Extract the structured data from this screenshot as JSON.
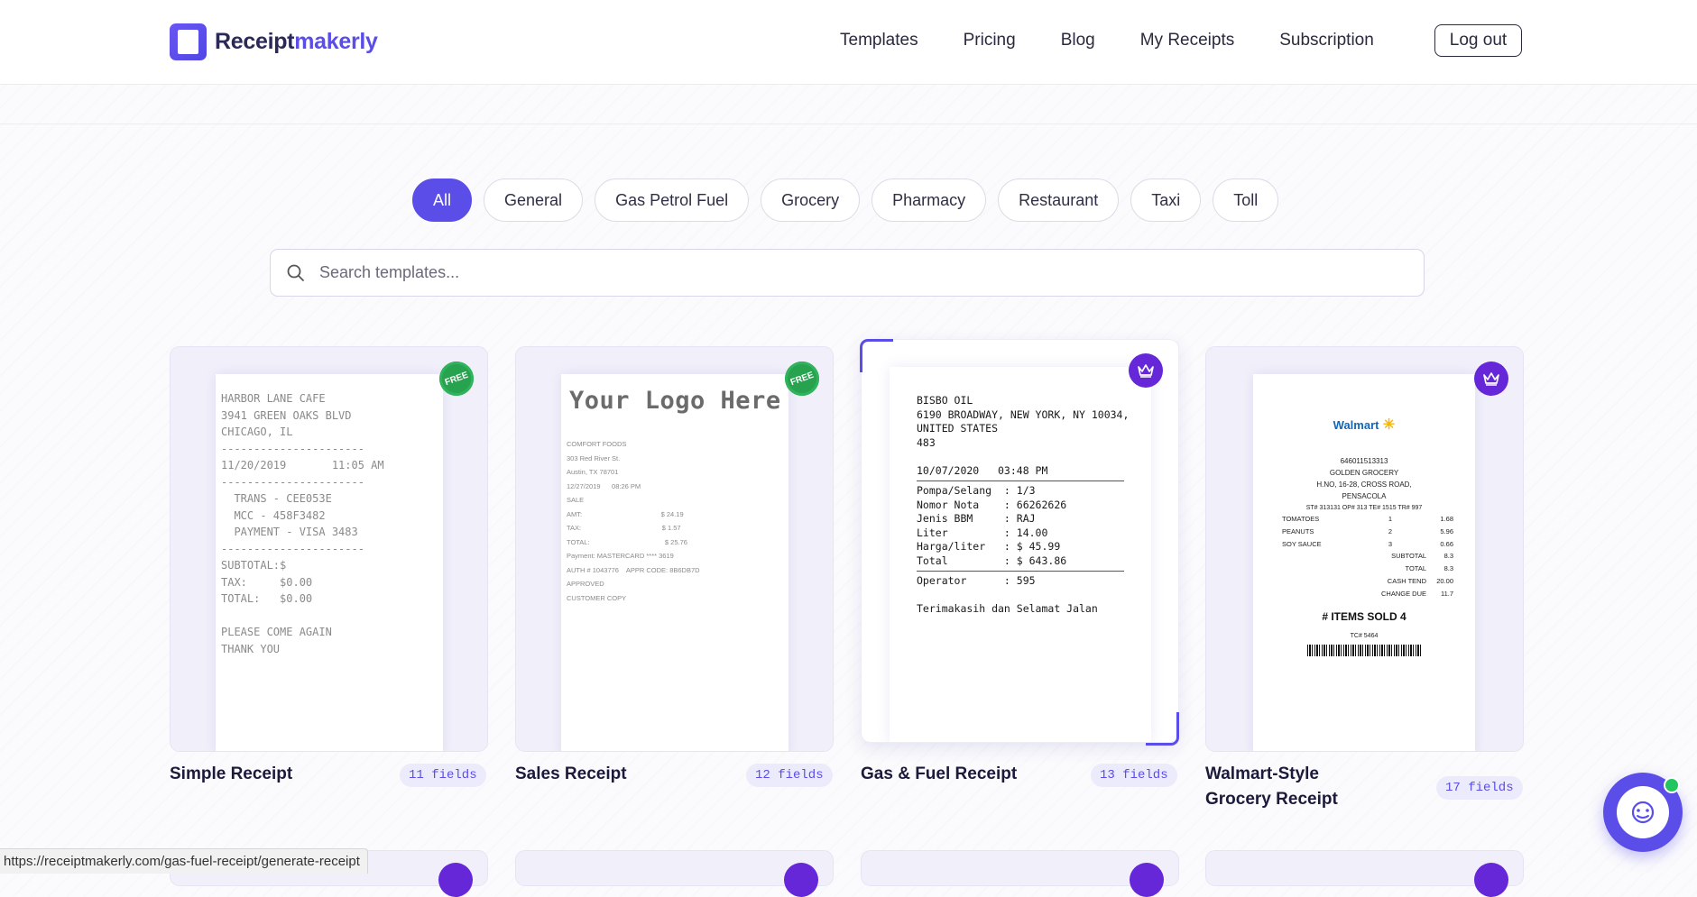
{
  "brand": {
    "part1": "Receipt",
    "part2": "makerly",
    "color": "#5a4de8"
  },
  "nav": {
    "templates": "Templates",
    "pricing": "Pricing",
    "blog": "Blog",
    "my_receipts": "My Receipts",
    "subscription": "Subscription",
    "logout": "Log out"
  },
  "filters": [
    "All",
    "General",
    "Gas Petrol Fuel",
    "Grocery",
    "Pharmacy",
    "Restaurant",
    "Taxi",
    "Toll"
  ],
  "active_filter": "All",
  "search": {
    "placeholder": "Search templates..."
  },
  "cards": [
    {
      "title": "Simple Receipt",
      "fields": "11 fields",
      "badge": "FREE",
      "receipt_lines": "HARBOR LANE CAFE\n3941 GREEN OAKS BLVD\nCHICAGO, IL\n----------------------\n11/20/2019       11:05 AM\n----------------------\n  TRANS - CEE053E\n  MCC - 458F3482\n  PAYMENT - VISA 3483\n----------------------\nSUBTOTAL:$\nTAX:     $0.00\nTOTAL:   $0.00\n\nPLEASE COME AGAIN\nTHANK YOU"
    },
    {
      "title": "Sales Receipt",
      "fields": "12 fields",
      "badge": "FREE",
      "logo_text": "Your Logo Here",
      "receipt_lines": "COMFORT FOODS\n303 Red River St.\nAustin, TX 78701\n12/27/2019      08:26 PM\nSALE\nAMT:                                          $ 24.19\nTAX:                                           $ 1.57\nTOTAL:                                        $ 25.76\nPayment: MASTERCARD **** 3619\nAUTH # 1043776    APPR CODE: 8B6DB7D\nAPPROVED\nCUSTOMER COPY"
    },
    {
      "title": "Gas & Fuel Receipt",
      "fields": "13 fields",
      "badge": "premium",
      "header_lines": "BISBO OIL\n6190 BROADWAY, NEW YORK, NY 10034,\nUNITED STATES\n483",
      "date_line": "10/07/2020   03:48 PM",
      "item_lines": "Pompa/Selang  : 1/3\nNomor Nota    : 66262626\nJenis BBM     : RAJ\nLiter         : 14.00\nHarga/liter   : $ 45.99\nTotal         : $ 643.86",
      "operator_line": "Operator      : 595",
      "footer_line": "Terimakasih dan Selamat Jalan"
    },
    {
      "title": "Walmart-Style Grocery Receipt",
      "fields": "17 fields",
      "badge": "premium",
      "logo_text": "Walmart",
      "logo_spark": "✳",
      "header_lines": [
        "646011513313",
        "GOLDEN GROCERY",
        "H.NO, 16-28, CROSS ROAD,",
        "PENSACOLA",
        "ST# 313131   OP# 313   TE# 1515   TR# 997"
      ],
      "items": [
        {
          "name": "TOMATOES",
          "qty": "1",
          "price": "1.68"
        },
        {
          "name": "PEANUTS",
          "qty": "2",
          "price": "5.96"
        },
        {
          "name": "SOY SAUCE",
          "qty": "3",
          "price": "0.66"
        }
      ],
      "totals": [
        {
          "label": "SUBTOTAL",
          "value": "8.3"
        },
        {
          "label": "TOTAL",
          "value": "8.3"
        },
        {
          "label": "CASH TEND",
          "value": "20.00"
        },
        {
          "label": "CHANGE DUE",
          "value": "11.7"
        }
      ],
      "items_sold": "# ITEMS SOLD 4",
      "tc": "TC# 5464"
    }
  ],
  "status_url": "https://receiptmakerly.com/gas-fuel-receipt/generate-receipt"
}
